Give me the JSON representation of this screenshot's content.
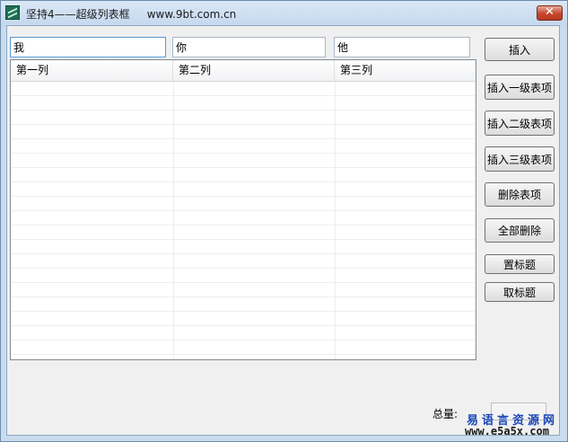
{
  "window": {
    "title": "坚持4——超级列表框     www.9bt.com.cn",
    "close_glyph": "✕"
  },
  "inputs": [
    {
      "value": "我"
    },
    {
      "value": "你"
    },
    {
      "value": "他"
    }
  ],
  "listview": {
    "columns": [
      "第一列",
      "第二列",
      "第三列"
    ]
  },
  "buttons": {
    "insert": "插入",
    "insert_level1": "插入一级表项",
    "insert_level2": "插入二级表项",
    "insert_level3": "插入三级表项",
    "delete_item": "删除表项",
    "delete_all": "全部删除",
    "set_title": "置标题",
    "get_title": "取标题"
  },
  "status": {
    "total_label": "总量:",
    "total_value": ""
  },
  "watermark": {
    "name": "易语言资源网",
    "url": "www.e5a5x.com"
  }
}
